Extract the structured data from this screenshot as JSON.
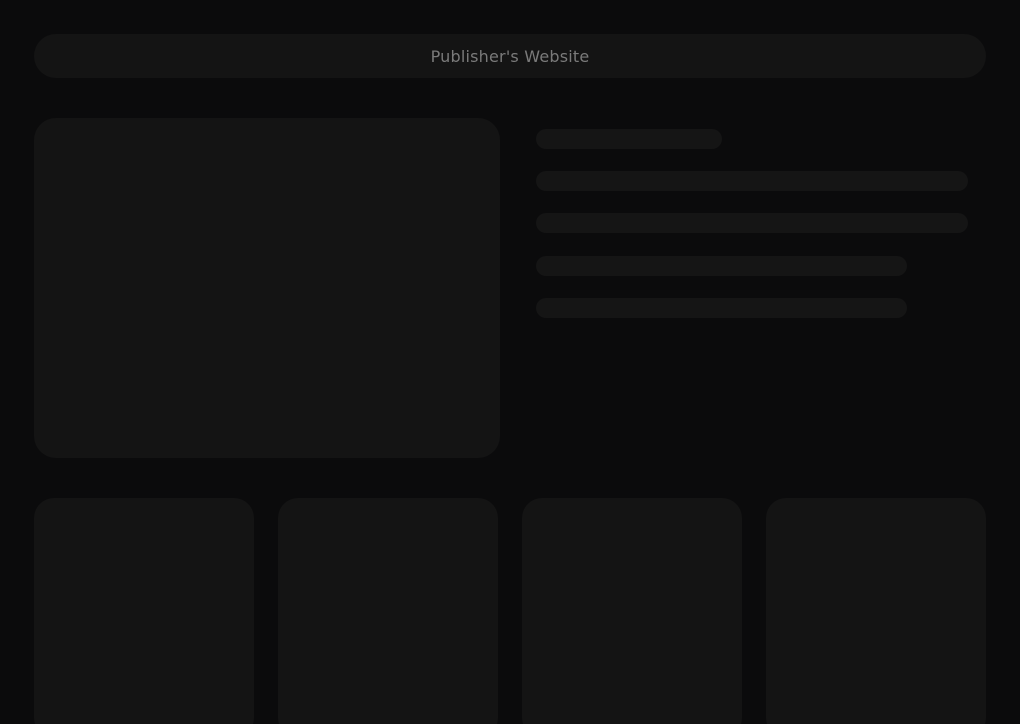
{
  "header": {
    "title": "Publisher's Website"
  },
  "colors": {
    "background": "#0b0b0c",
    "skeleton": "#141414",
    "header_text": "#7a7a7a"
  }
}
